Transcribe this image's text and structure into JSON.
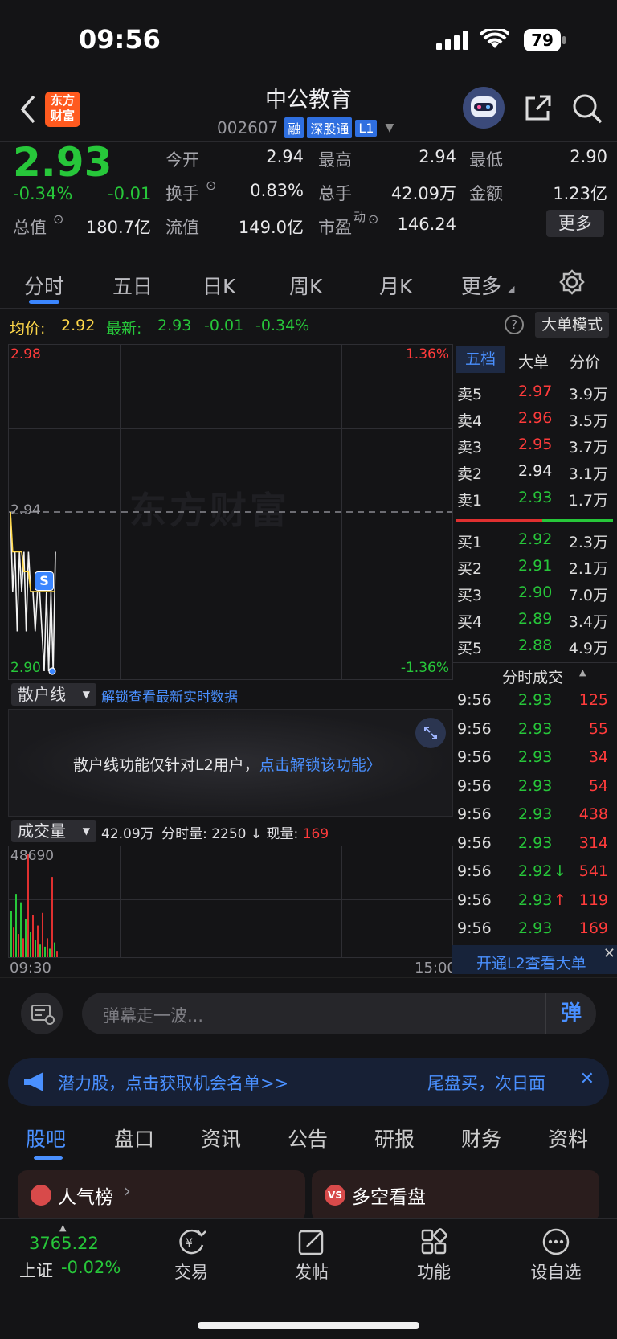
{
  "status_bar": {
    "time": "09:56",
    "battery": "79"
  },
  "header": {
    "logo_line1": "东方",
    "logo_line2": "财富",
    "stock_name": "中公教育",
    "stock_code": "002607",
    "badges": [
      "融",
      "深股通",
      "L1"
    ]
  },
  "quote": {
    "price": "2.93",
    "change_pct": "-0.34%",
    "change": "-0.01",
    "rows": [
      [
        {
          "label": "今开",
          "value": "2.94"
        },
        {
          "label": "最高",
          "value": "2.94"
        },
        {
          "label": "最低",
          "value": "2.90"
        }
      ],
      [
        {
          "label": "换手",
          "value": "0.83%"
        },
        {
          "label": "总手",
          "value": "42.09万"
        },
        {
          "label": "金额",
          "value": "1.23亿"
        }
      ],
      [
        {
          "label": "总值",
          "value": "180.7亿"
        },
        {
          "label": "流值",
          "value": "149.0亿"
        },
        {
          "label": "市盈",
          "value": "146.24"
        }
      ]
    ],
    "pe_sup": "动",
    "more_label": "更多"
  },
  "chart_tabs": [
    "分时",
    "五日",
    "日K",
    "周K",
    "月K",
    "更多"
  ],
  "avg_line": {
    "avg_label": "均价:",
    "avg_value": "2.92",
    "latest_label": "最新:",
    "latest_value": "2.93",
    "latest_change": "-0.01",
    "latest_pct": "-0.34%",
    "big_order_mode": "大单模式"
  },
  "chart_data": {
    "type": "line",
    "y_labels": {
      "top": "2.98",
      "mid": "2.94",
      "bottom": "2.90"
    },
    "pct_labels": {
      "top": "1.36%",
      "bottom": "-1.36%"
    },
    "ylim": [
      2.9,
      2.98
    ],
    "prev_close": 2.94,
    "price_series": [
      2.94,
      2.92,
      2.93,
      2.91,
      2.93,
      2.92,
      2.93,
      2.91,
      2.93,
      2.92,
      2.92,
      2.91,
      2.92,
      2.92,
      2.91,
      2.9,
      2.92,
      2.9,
      2.92,
      2.9,
      2.93
    ],
    "avg_series": [
      2.94,
      2.93,
      2.93,
      2.93,
      2.93,
      2.93,
      2.925,
      2.925,
      2.925,
      2.92,
      2.92,
      2.92,
      2.92,
      2.92,
      2.92,
      2.92,
      2.92,
      2.92,
      2.92,
      2.92,
      2.92
    ],
    "volume_max_label": "48690",
    "volume_series": [
      22000,
      14000,
      30000,
      11000,
      26000,
      9000,
      18000,
      48690,
      12000,
      20000,
      8000,
      15000,
      6000,
      21000,
      5000,
      9000,
      4000,
      38000,
      7000,
      3000
    ],
    "x_start": "09:30",
    "x_end": "15:00",
    "watermark": "东方财富",
    "marker": "S"
  },
  "retail_line": {
    "selector": "散户线",
    "unlock_link": "解锁查看最新实时数据",
    "notice": "散户线功能仅针对L2用户，",
    "notice_link": "点击解锁该功能"
  },
  "volume_bar": {
    "selector": "成交量",
    "total": "42.09万",
    "period_label": "分时量: 2250",
    "now_label": "现量:",
    "now_value": "169"
  },
  "order_book": {
    "tabs": [
      "五档",
      "大单",
      "分价"
    ],
    "asks": [
      {
        "label": "卖5",
        "price": "2.97",
        "vol": "3.9万",
        "color": "red"
      },
      {
        "label": "卖4",
        "price": "2.96",
        "vol": "3.5万",
        "color": "red"
      },
      {
        "label": "卖3",
        "price": "2.95",
        "vol": "3.7万",
        "color": "red"
      },
      {
        "label": "卖2",
        "price": "2.94",
        "vol": "3.1万",
        "color": "white"
      },
      {
        "label": "卖1",
        "price": "2.93",
        "vol": "1.7万",
        "color": "green"
      }
    ],
    "bids": [
      {
        "label": "买1",
        "price": "2.92",
        "vol": "2.3万"
      },
      {
        "label": "买2",
        "price": "2.91",
        "vol": "2.1万"
      },
      {
        "label": "买3",
        "price": "2.90",
        "vol": "7.0万"
      },
      {
        "label": "买4",
        "price": "2.89",
        "vol": "3.4万"
      },
      {
        "label": "买5",
        "price": "2.88",
        "vol": "4.9万"
      }
    ],
    "trades_title": "分时成交",
    "trades": [
      {
        "time": "9:56",
        "price": "2.93",
        "arrow": "",
        "vol": "125"
      },
      {
        "time": "9:56",
        "price": "2.93",
        "arrow": "",
        "vol": "55"
      },
      {
        "time": "9:56",
        "price": "2.93",
        "arrow": "",
        "vol": "34"
      },
      {
        "time": "9:56",
        "price": "2.93",
        "arrow": "",
        "vol": "54"
      },
      {
        "time": "9:56",
        "price": "2.93",
        "arrow": "",
        "vol": "438"
      },
      {
        "time": "9:56",
        "price": "2.93",
        "arrow": "",
        "vol": "314"
      },
      {
        "time": "9:56",
        "price": "2.92",
        "arrow": "↓",
        "vol": "541"
      },
      {
        "time": "9:56",
        "price": "2.93",
        "arrow": "↑",
        "vol": "119"
      },
      {
        "time": "9:56",
        "price": "2.93",
        "arrow": "",
        "vol": "169"
      }
    ],
    "l2_banner": "开通L2查看大单"
  },
  "danmu": {
    "placeholder": "弹幕走一波...",
    "send": "弹"
  },
  "promo": {
    "left": "潜力股，点击获取机会名单>>",
    "right": "尾盘买，次日面"
  },
  "bottom_tabs": [
    "股吧",
    "盘口",
    "资讯",
    "公告",
    "研报",
    "财务",
    "资料"
  ],
  "cards": [
    {
      "label": "人气榜"
    },
    {
      "label": "多空看盘"
    }
  ],
  "nav": {
    "index_value": "3765.22",
    "index_name": "上证",
    "index_change": "-0.02%",
    "items": [
      "交易",
      "发帖",
      "功能",
      "设自选"
    ]
  }
}
